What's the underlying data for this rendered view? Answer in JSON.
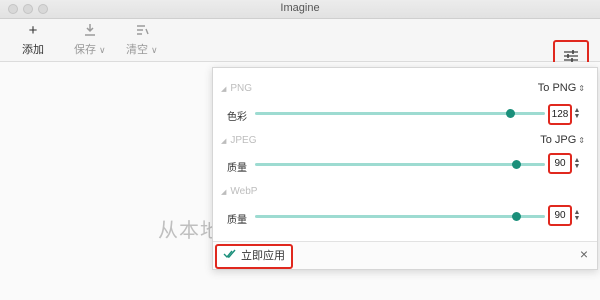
{
  "window": {
    "title": "Imagine"
  },
  "toolbar": {
    "add_label": "添加",
    "save_label": "保存",
    "clear_label": "清空"
  },
  "main": {
    "placeholder": "从本地"
  },
  "panel": {
    "png": {
      "section": "PNG",
      "format": "To PNG",
      "param": "色彩",
      "value": "128",
      "level_percent": 88
    },
    "jpeg": {
      "section": "JPEG",
      "format": "To JPG",
      "param": "质量",
      "value": "90",
      "level_percent": 90
    },
    "webp": {
      "section": "WebP",
      "param": "质量",
      "value": "90",
      "level_percent": 90
    },
    "apply_label": "立即应用",
    "close_icon": "close-icon"
  },
  "colors": {
    "accent": "#1a8f7a",
    "track": "#9ddbd1",
    "highlight": "#e0281e"
  }
}
